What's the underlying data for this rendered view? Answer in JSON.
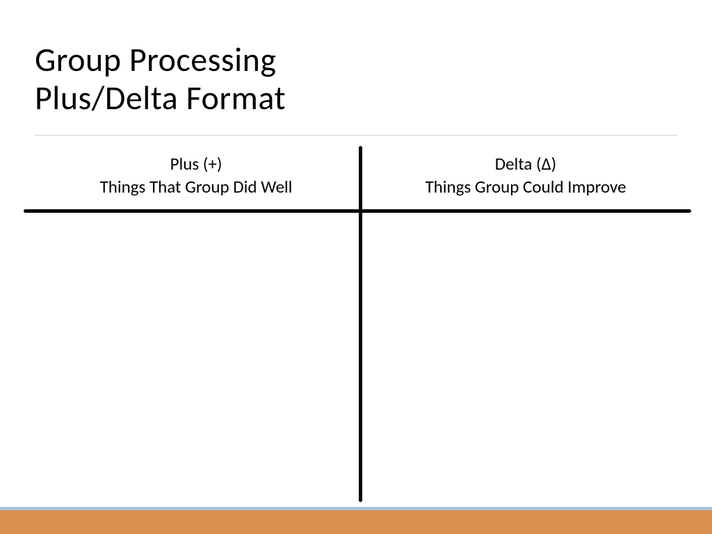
{
  "title": {
    "line1": "Group Processing",
    "line2": "Plus/Delta Format"
  },
  "columns": {
    "left": {
      "header_line1": "Plus (+)",
      "header_line2": "Things That Group Did Well"
    },
    "right": {
      "header_line1": "Delta (∆)",
      "header_line2": "Things Group Could Improve"
    }
  }
}
